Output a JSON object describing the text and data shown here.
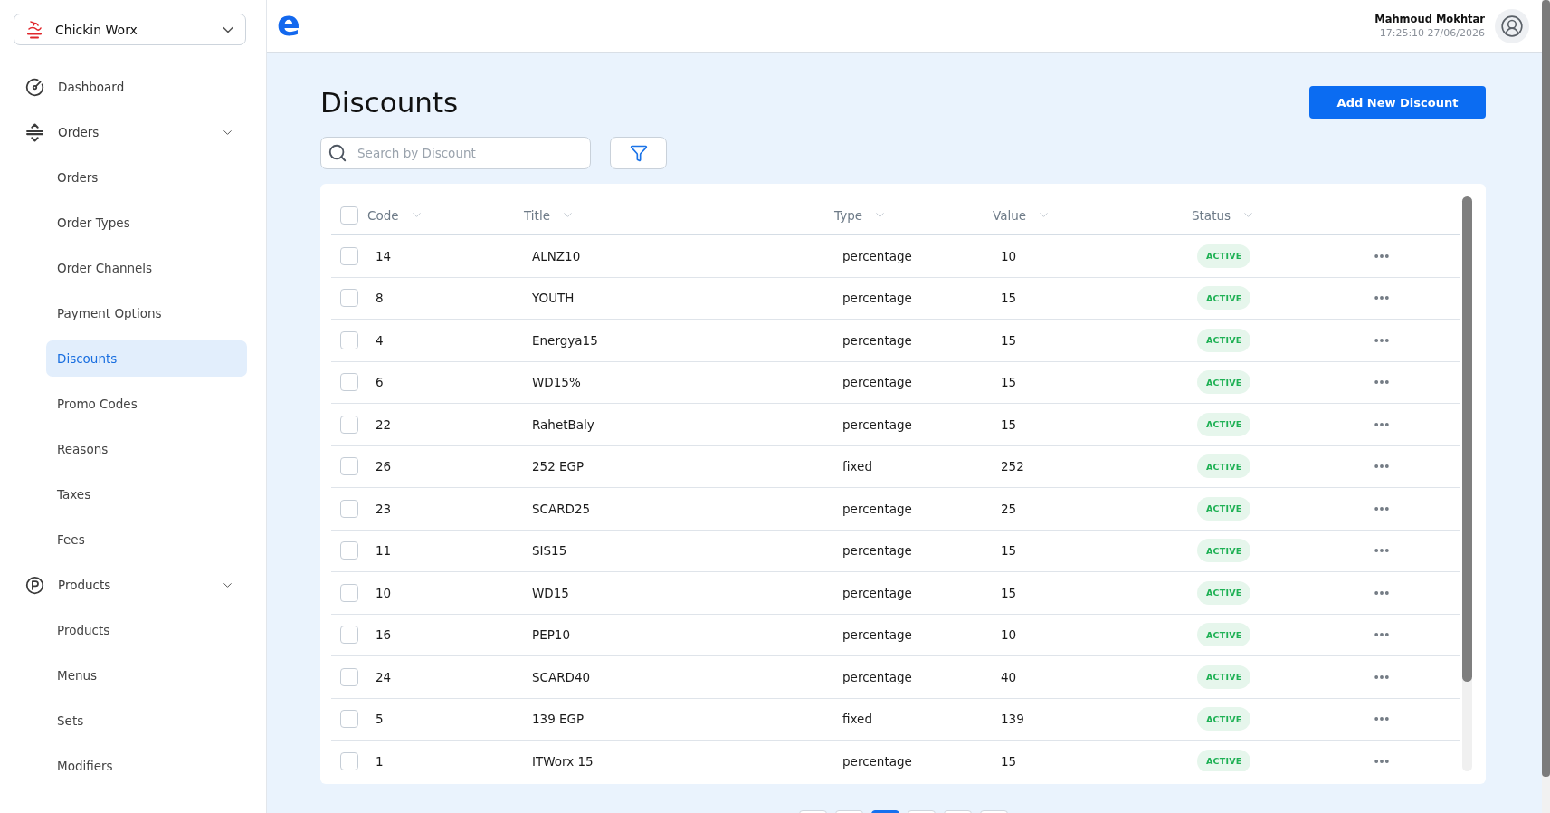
{
  "sidebar": {
    "restaurant": "Chickin Worx",
    "nav": [
      {
        "kind": "link",
        "label": "Dashboard",
        "selected": false
      },
      {
        "kind": "group",
        "label": "Orders",
        "selected": false,
        "expanded": true,
        "children": [
          {
            "label": "Orders",
            "selected": false
          },
          {
            "label": "Order Types",
            "selected": false
          },
          {
            "label": "Order Channels",
            "selected": false
          },
          {
            "label": "Payment Options",
            "selected": false
          },
          {
            "label": "Discounts",
            "selected": true
          },
          {
            "label": "Promo Codes",
            "selected": false
          },
          {
            "label": "Reasons",
            "selected": false
          },
          {
            "label": "Taxes",
            "selected": false
          },
          {
            "label": "Fees",
            "selected": false
          }
        ]
      },
      {
        "kind": "group",
        "label": "Products",
        "selected": false,
        "expanded": true,
        "children": [
          {
            "label": "Products",
            "selected": false
          },
          {
            "label": "Menus",
            "selected": false
          },
          {
            "label": "Sets",
            "selected": false
          },
          {
            "label": "Modifiers",
            "selected": false
          }
        ]
      }
    ]
  },
  "top_bar": {
    "logo": "e",
    "user_name": "Mahmoud Mokhtar",
    "timestamp": "17:25:10 27/06/2026"
  },
  "page": {
    "title": "Discounts",
    "add_button": "Add New Discount",
    "search": {
      "placeholder": "Search by Discount"
    }
  },
  "table": {
    "select_all_checked": false,
    "columns": [
      "Code",
      "Title",
      "Type",
      "Value",
      "Status"
    ],
    "rows": [
      {
        "checked": false,
        "code": "14",
        "title": "ALNZ10",
        "type": "percentage",
        "value": "10",
        "status": {
          "label": "ACTIVE",
          "kind": "active"
        }
      },
      {
        "checked": false,
        "code": "8",
        "title": "YOUTH",
        "type": "percentage",
        "value": "15",
        "status": {
          "label": "ACTIVE",
          "kind": "active"
        }
      },
      {
        "checked": false,
        "code": "4",
        "title": "Energya15",
        "type": "percentage",
        "value": "15",
        "status": {
          "label": "ACTIVE",
          "kind": "active"
        }
      },
      {
        "checked": false,
        "code": "6",
        "title": "WD15%",
        "type": "percentage",
        "value": "15",
        "status": {
          "label": "ACTIVE",
          "kind": "active"
        }
      },
      {
        "checked": false,
        "code": "22",
        "title": "RahetBaly",
        "type": "percentage",
        "value": "15",
        "status": {
          "label": "ACTIVE",
          "kind": "active"
        }
      },
      {
        "checked": false,
        "code": "26",
        "title": "252 EGP",
        "type": "fixed",
        "value": "252",
        "status": {
          "label": "ACTIVE",
          "kind": "active"
        }
      },
      {
        "checked": false,
        "code": "23",
        "title": "SCARD25",
        "type": "percentage",
        "value": "25",
        "status": {
          "label": "ACTIVE",
          "kind": "active"
        }
      },
      {
        "checked": false,
        "code": "11",
        "title": "SIS15",
        "type": "percentage",
        "value": "15",
        "status": {
          "label": "ACTIVE",
          "kind": "active"
        }
      },
      {
        "checked": false,
        "code": "10",
        "title": "WD15",
        "type": "percentage",
        "value": "15",
        "status": {
          "label": "ACTIVE",
          "kind": "active"
        }
      },
      {
        "checked": false,
        "code": "16",
        "title": "PEP10",
        "type": "percentage",
        "value": "10",
        "status": {
          "label": "ACTIVE",
          "kind": "active"
        }
      },
      {
        "checked": false,
        "code": "24",
        "title": "SCARD40",
        "type": "percentage",
        "value": "40",
        "status": {
          "label": "ACTIVE",
          "kind": "active"
        }
      },
      {
        "checked": false,
        "code": "5",
        "title": "139 EGP",
        "type": "fixed",
        "value": "139",
        "status": {
          "label": "ACTIVE",
          "kind": "active"
        }
      },
      {
        "checked": false,
        "code": "1",
        "title": "ITWorx 15",
        "type": "percentage",
        "value": "15",
        "status": {
          "label": "ACTIVE",
          "kind": "active"
        }
      }
    ]
  },
  "pagination": [
    {
      "selected": false
    },
    {
      "selected": false
    },
    {
      "selected": true
    },
    {
      "selected": false
    },
    {
      "selected": false
    },
    {
      "selected": false
    }
  ]
}
